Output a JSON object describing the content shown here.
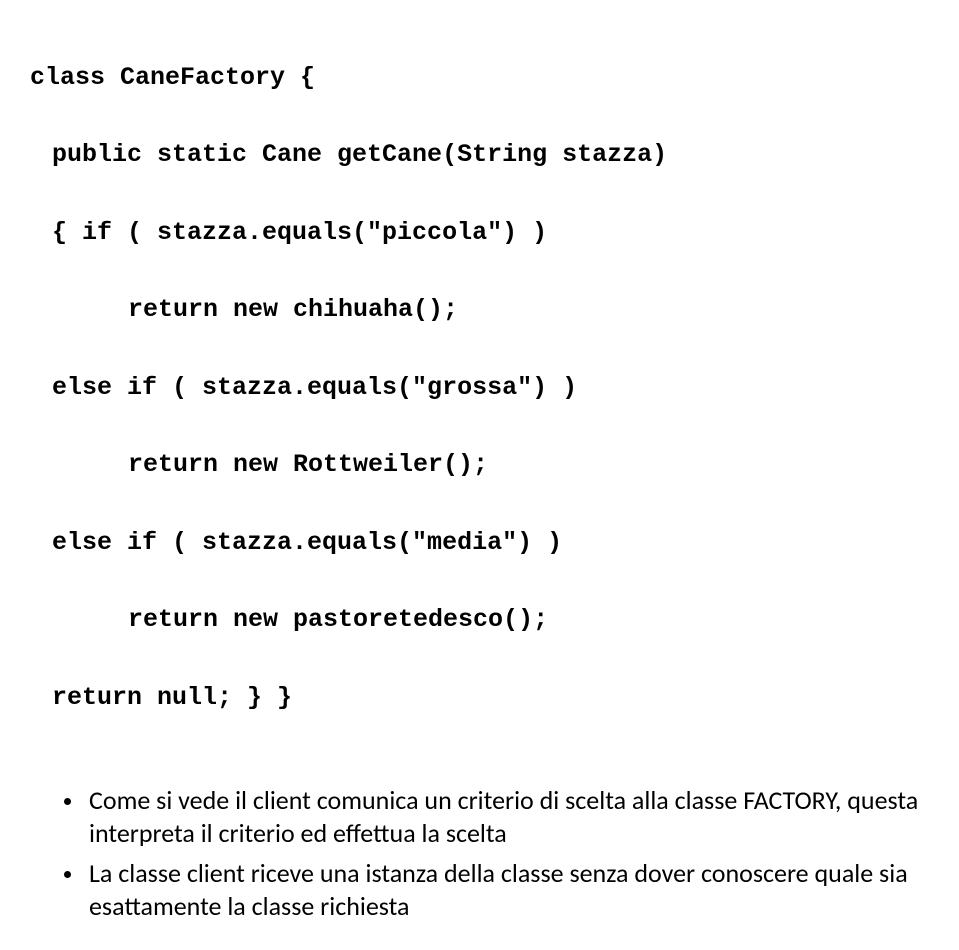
{
  "code": {
    "l1": "class CaneFactory {",
    "l2": "public static Cane getCane(String stazza)",
    "l3": "{ if ( stazza.equals(\"piccola\") )",
    "l4": "return new chihuaha();",
    "l5": "else if ( stazza.equals(\"grossa\") )",
    "l6": "return new Rottweiler();",
    "l7": "else if ( stazza.equals(\"media\") )",
    "l8": "return new pastoretedesco();",
    "l9": "return null; } }"
  },
  "bullets": {
    "b1": "Come si vede il client comunica un criterio di scelta alla classe FACTORY, questa interpreta il criterio ed effettua la scelta",
    "b2": "La classe client riceve una istanza della classe senza dover conoscere quale sia esattamente la classe richiesta"
  }
}
